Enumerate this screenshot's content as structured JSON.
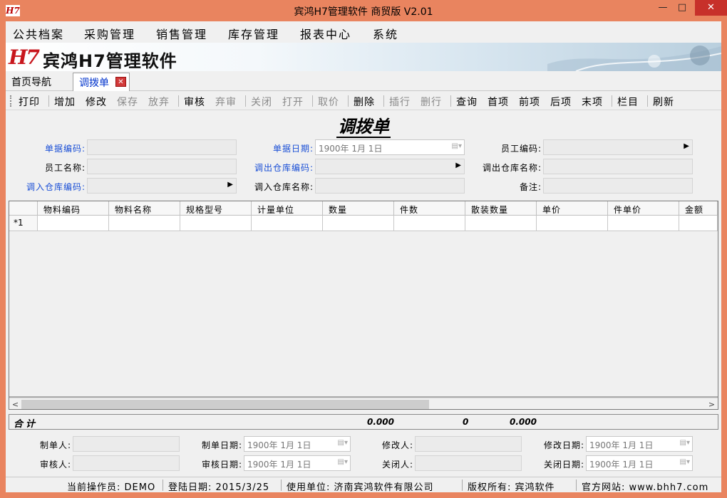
{
  "window": {
    "app_icon_text": "H7",
    "title": "宾鸿H7管理软件 商贸版 V2.01",
    "minimize": "—",
    "maximize": "□",
    "close": "✕"
  },
  "menu": [
    "公共档案",
    "采购管理",
    "销售管理",
    "库存管理",
    "报表中心",
    "系统"
  ],
  "banner": {
    "logo": "H7",
    "title": "宾鸿H7管理软件"
  },
  "tabs": {
    "home": "首页导航",
    "active": "调拨单",
    "close": "✕"
  },
  "toolbar": {
    "print": "打印",
    "add": "增加",
    "edit": "修改",
    "save": "保存",
    "discard": "放弃",
    "audit": "审核",
    "unaudit": "弃审",
    "close": "关闭",
    "open": "打开",
    "fetch_price": "取价",
    "delete": "删除",
    "insert_row": "插行",
    "delete_row": "删行",
    "query": "查询",
    "first": "首项",
    "prev": "前项",
    "next": "后项",
    "last": "末项",
    "columns": "栏目",
    "refresh": "刷新"
  },
  "form": {
    "title": "调拨单",
    "doc_no_label": "单据编码:",
    "doc_no_value": "",
    "doc_date_label": "单据日期:",
    "doc_date_value": "1900年 1月 1日",
    "emp_code_label": "员工编码:",
    "emp_code_value": "",
    "emp_name_label": "员工名称:",
    "emp_name_value": "",
    "out_wh_code_label": "调出仓库编码:",
    "out_wh_code_value": "",
    "out_wh_name_label": "调出仓库名称:",
    "out_wh_name_value": "",
    "in_wh_code_label": "调入仓库编码:",
    "in_wh_code_value": "",
    "in_wh_name_label": "调入仓库名称:",
    "in_wh_name_value": "",
    "remark_label": "备注:",
    "remark_value": ""
  },
  "grid": {
    "columns": [
      "物料编码",
      "物料名称",
      "规格型号",
      "计量单位",
      "数量",
      "件数",
      "散装数量",
      "单价",
      "件单价",
      "金额"
    ],
    "new_row_marker": "*1",
    "scroll_left": "<",
    "scroll_right": ">"
  },
  "summary": {
    "label": "合计",
    "qty": "0.000",
    "pieces": "0",
    "bulk_qty": "0.000"
  },
  "footer": {
    "creator_label": "制单人:",
    "creator_value": "",
    "create_date_label": "制单日期:",
    "create_date_value": "1900年 1月 1日",
    "modifier_label": "修改人:",
    "modifier_value": "",
    "modify_date_label": "修改日期:",
    "modify_date_value": "1900年 1月 1日",
    "auditor_label": "审核人:",
    "auditor_value": "",
    "audit_date_label": "审核日期:",
    "audit_date_value": "1900年 1月 1日",
    "closer_label": "关闭人:",
    "closer_value": "",
    "close_date_label": "关闭日期:",
    "close_date_value": "1900年 1月 1日"
  },
  "status": {
    "operator": "当前操作员: DEMO",
    "login_date": "登陆日期: 2015/3/25",
    "company": "使用单位: 济南宾鸿软件有限公司",
    "copyright": "版权所有: 宾鸿软件",
    "website": "官方网站: www.bhh7.com"
  },
  "colors": {
    "title_bar": "#e9845f",
    "close_button": "#c7302a",
    "label_blue": "#1a4fd6",
    "logo_red": "#c8161d"
  }
}
